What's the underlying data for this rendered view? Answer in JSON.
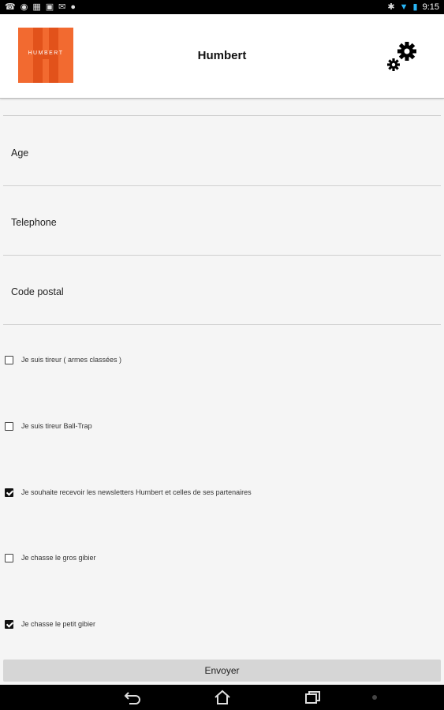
{
  "status_bar": {
    "time": "9:15",
    "left_icons": [
      "whatsapp-icon",
      "globe-icon",
      "image-icon",
      "gallery-icon",
      "email-icon",
      "chat-icon"
    ],
    "right_icons": [
      "bluetooth-icon",
      "wifi-icon",
      "battery-icon"
    ]
  },
  "header": {
    "logo_text": "HUMBERT",
    "title": "Humbert",
    "logo_color": "#f26a30"
  },
  "form": {
    "fields": [
      {
        "label": "Age"
      },
      {
        "label": "Telephone"
      },
      {
        "label": "Code postal"
      }
    ],
    "checkboxes": [
      {
        "label": "Je suis tireur ( armes classées )",
        "checked": false
      },
      {
        "label": "Je suis tireur Ball-Trap",
        "checked": false
      },
      {
        "label": "Je souhaite recevoir les newsletters Humbert et celles de ses partenaires",
        "checked": true
      },
      {
        "label": "Je chasse le gros gibier",
        "checked": false
      },
      {
        "label": "Je chasse le petit gibier",
        "checked": true
      }
    ],
    "submit_label": "Envoyer"
  },
  "nav_bar": {
    "buttons": [
      "back-icon",
      "home-icon",
      "recent-apps-icon"
    ]
  }
}
